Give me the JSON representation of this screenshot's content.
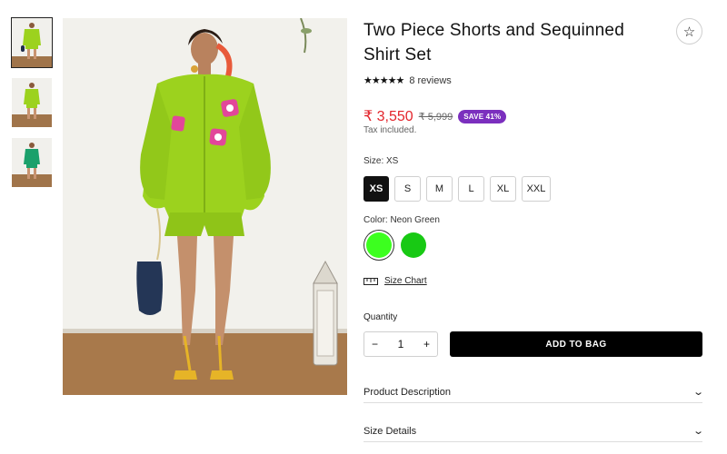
{
  "product": {
    "title": "Two Piece Shorts and Sequinned Shirt Set",
    "stars": "★★★★★",
    "reviews": "8 reviews",
    "price": "₹ 3,550",
    "compare_price": "₹ 5,999",
    "badge": "SAVE 41%",
    "tax_note": "Tax included."
  },
  "size": {
    "label": "Size: XS",
    "options": [
      "XS",
      "S",
      "M",
      "L",
      "XL",
      "XXL"
    ],
    "selected": "XS"
  },
  "color": {
    "label": "Color: Neon Green",
    "swatches": [
      "#3cff1f",
      "#18c914"
    ],
    "selected_index": 0
  },
  "size_chart": "Size Chart",
  "quantity": {
    "label": "Quantity",
    "value": "1",
    "minus": "−",
    "plus": "+"
  },
  "add_to_bag": "ADD TO BAG",
  "accordions": {
    "description": "Product Description",
    "size_details": "Size Details"
  },
  "icons": {
    "wishlist": "☆",
    "chevron": "⌄"
  },
  "colors": {
    "price": "#e3242b",
    "badge": "#7b2fbe",
    "outfit": "#9cd21e",
    "button": "#000000"
  }
}
